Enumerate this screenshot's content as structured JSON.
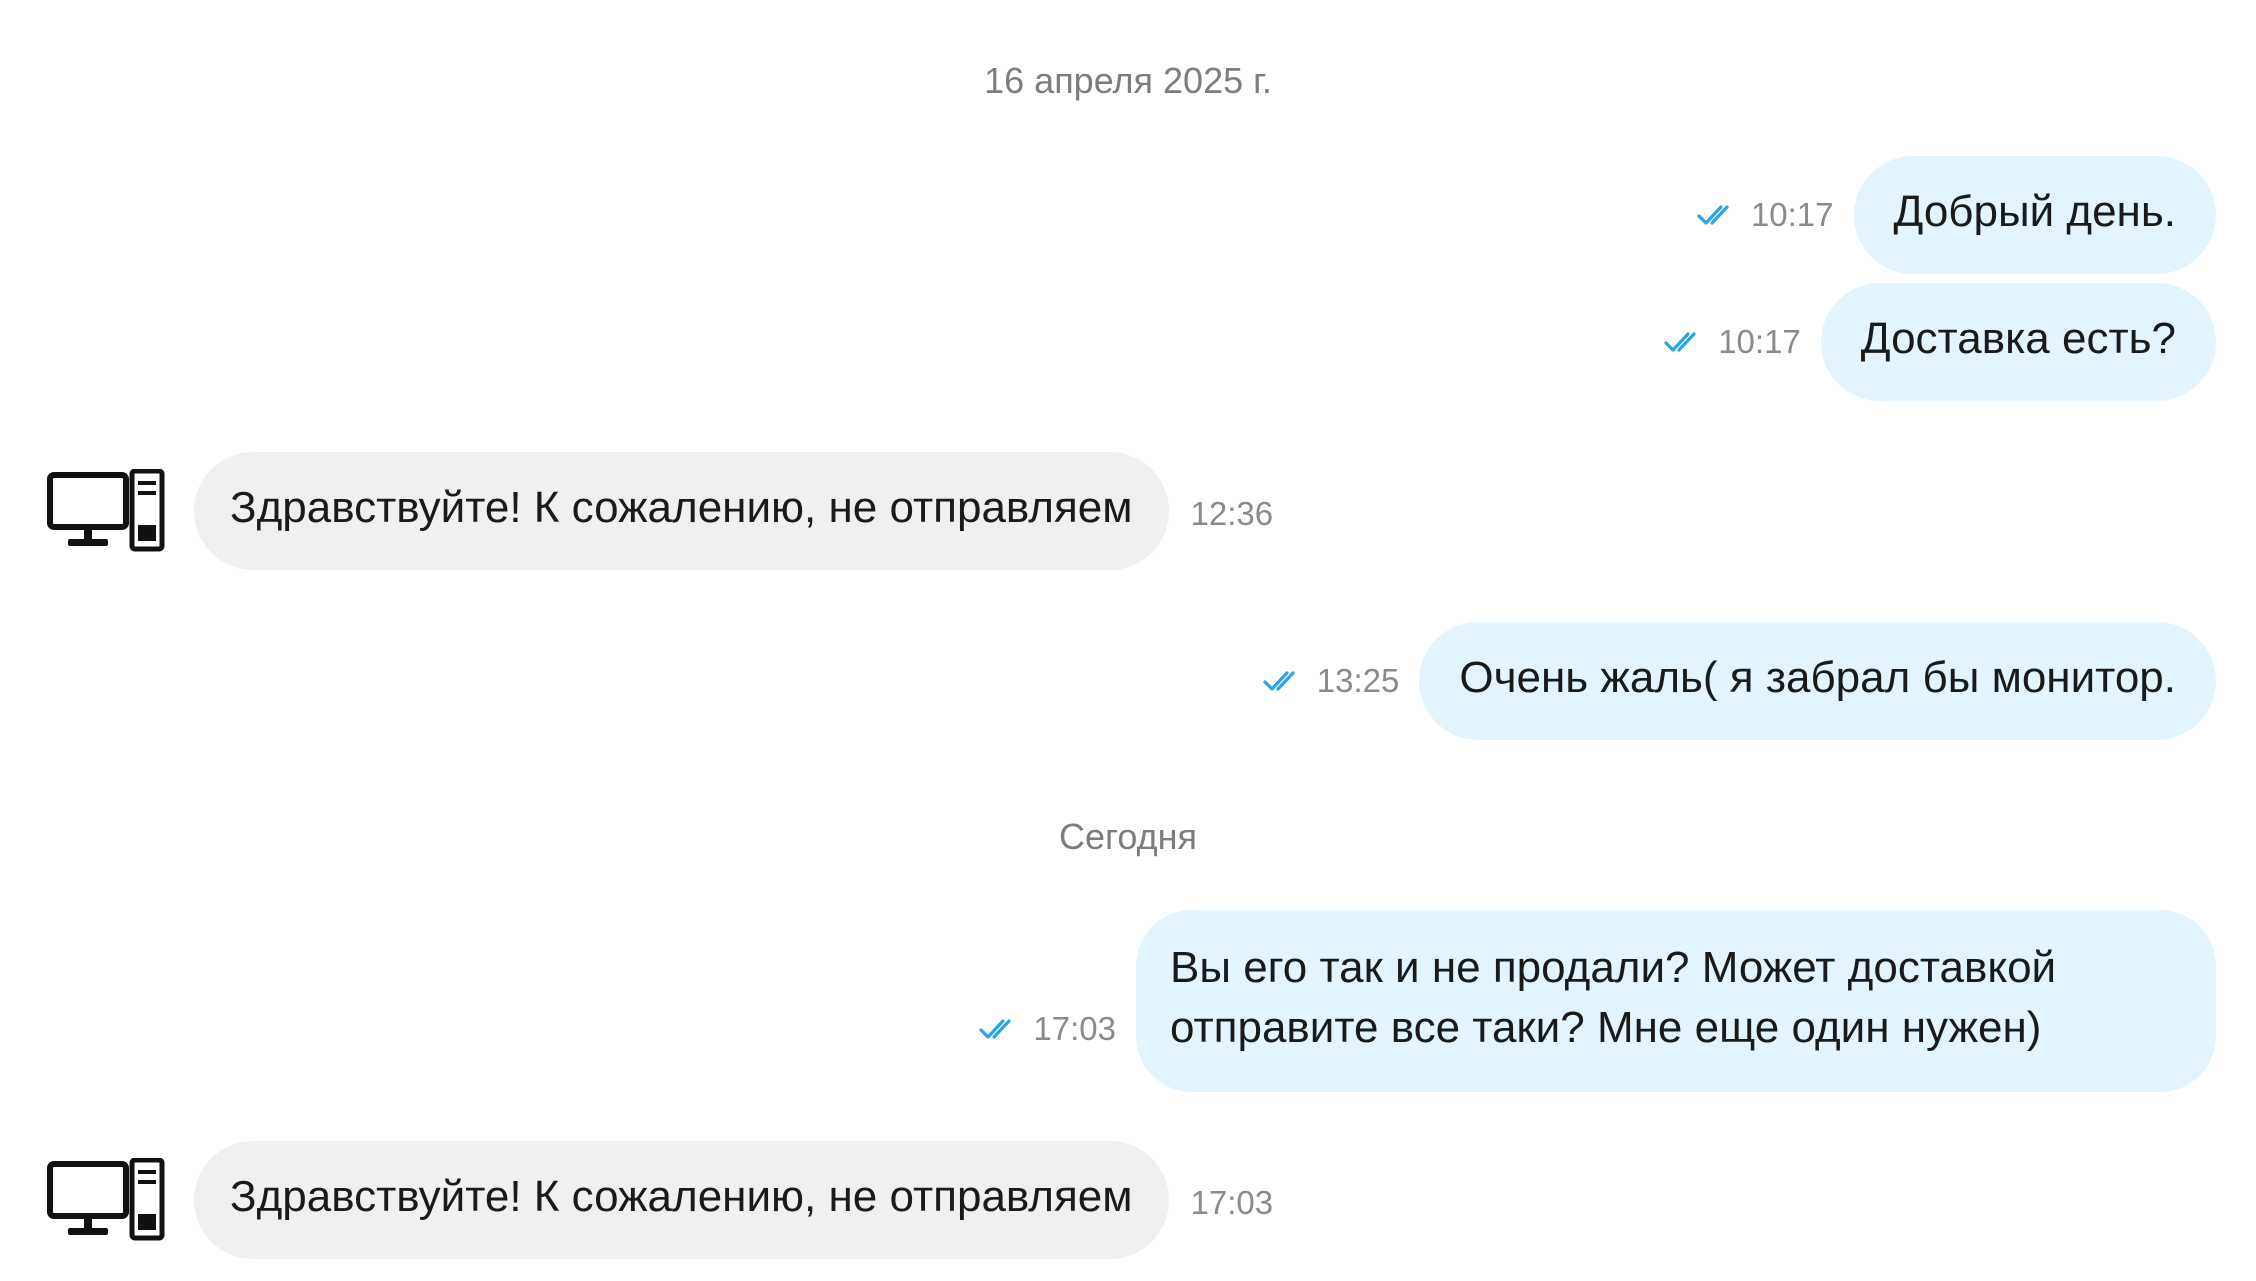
{
  "dates": {
    "first": "16 апреля 2025 г.",
    "second": "Сегодня"
  },
  "messages": [
    {
      "direction": "out",
      "text": "Добрый день.",
      "time": "10:17",
      "status": "read"
    },
    {
      "direction": "out",
      "text": "Доставка есть?",
      "time": "10:17",
      "status": "read"
    },
    {
      "direction": "in",
      "text": "Здравствуйте! К сожалению, не отправляем",
      "time": "12:36",
      "avatar": "computer-icon"
    },
    {
      "direction": "out",
      "text": "Очень жаль( я забрал бы монитор.",
      "time": "13:25",
      "status": "read"
    },
    {
      "direction": "out",
      "text": "Вы его так и не продали? Может доставкой отправите все таки? Мне еще один нужен)",
      "time": "17:03",
      "status": "read"
    },
    {
      "direction": "in",
      "text": "Здравствуйте! К сожалению, не отправляем",
      "time": "17:03",
      "avatar": "computer-icon"
    }
  ],
  "colors": {
    "outgoing_bubble": "#e3f4ff",
    "incoming_bubble": "#f0f0f0",
    "read_check": "#2aa4e8",
    "meta_text": "#8a8a8a"
  }
}
